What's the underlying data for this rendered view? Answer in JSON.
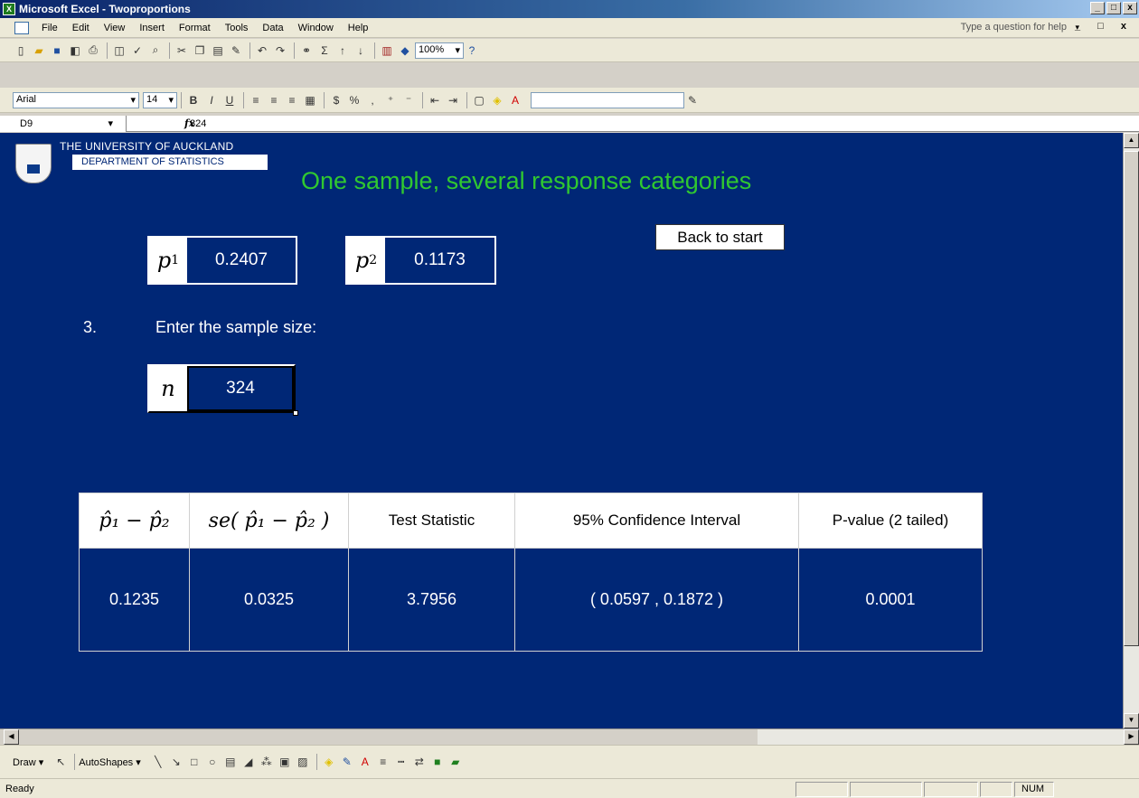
{
  "window": {
    "title": "Microsoft Excel - Twoproportions",
    "app_icon": "X",
    "controls": [
      "_",
      "□",
      "x"
    ]
  },
  "menu": {
    "items": [
      "File",
      "Edit",
      "View",
      "Insert",
      "Format",
      "Tools",
      "Data",
      "Window",
      "Help"
    ],
    "help_placeholder": "Type a question for help",
    "mdi_controls": "_ □ x"
  },
  "toolbar": {
    "zoom": "100%",
    "font_name": "Arial",
    "font_size": "14",
    "bold_label": "B",
    "italic_label": "I",
    "underline_label": "U",
    "currency_label": "$",
    "percent_label": "%"
  },
  "formula_bar": {
    "cell_ref": "D9",
    "fx_label": "fx",
    "value": "324"
  },
  "sheet": {
    "university": "THE UNIVERSITY OF AUCKLAND",
    "department": "DEPARTMENT OF STATISTICS",
    "heading": "One sample, several response categories",
    "back_button": "Back to start",
    "p1": {
      "symbol": "p",
      "sub": "1",
      "value": "0.2407"
    },
    "p2": {
      "symbol": "p",
      "sub": "2",
      "value": "0.1173"
    },
    "step_number": "3.",
    "step_text": "Enter the sample size:",
    "n": {
      "symbol": "n",
      "value": "324"
    },
    "table": {
      "headers": [
        "p̂₁ − p̂₂",
        "se( p̂₁ − p̂₂ )",
        "Test Statistic",
        "95% Confidence Interval",
        "P-value (2 tailed)"
      ],
      "values": [
        "0.1235",
        "0.0325",
        "3.7956",
        "( 0.0597 , 0.1872 )",
        "0.0001"
      ]
    }
  },
  "drawbar": {
    "draw_label": "Draw ▾",
    "autoshapes_label": "AutoShapes ▾"
  },
  "status": {
    "ready": "Ready",
    "num": "NUM"
  },
  "colors": {
    "sheet_bg": "#002776",
    "heading": "#30c830",
    "title_bar": "#0a246a"
  }
}
